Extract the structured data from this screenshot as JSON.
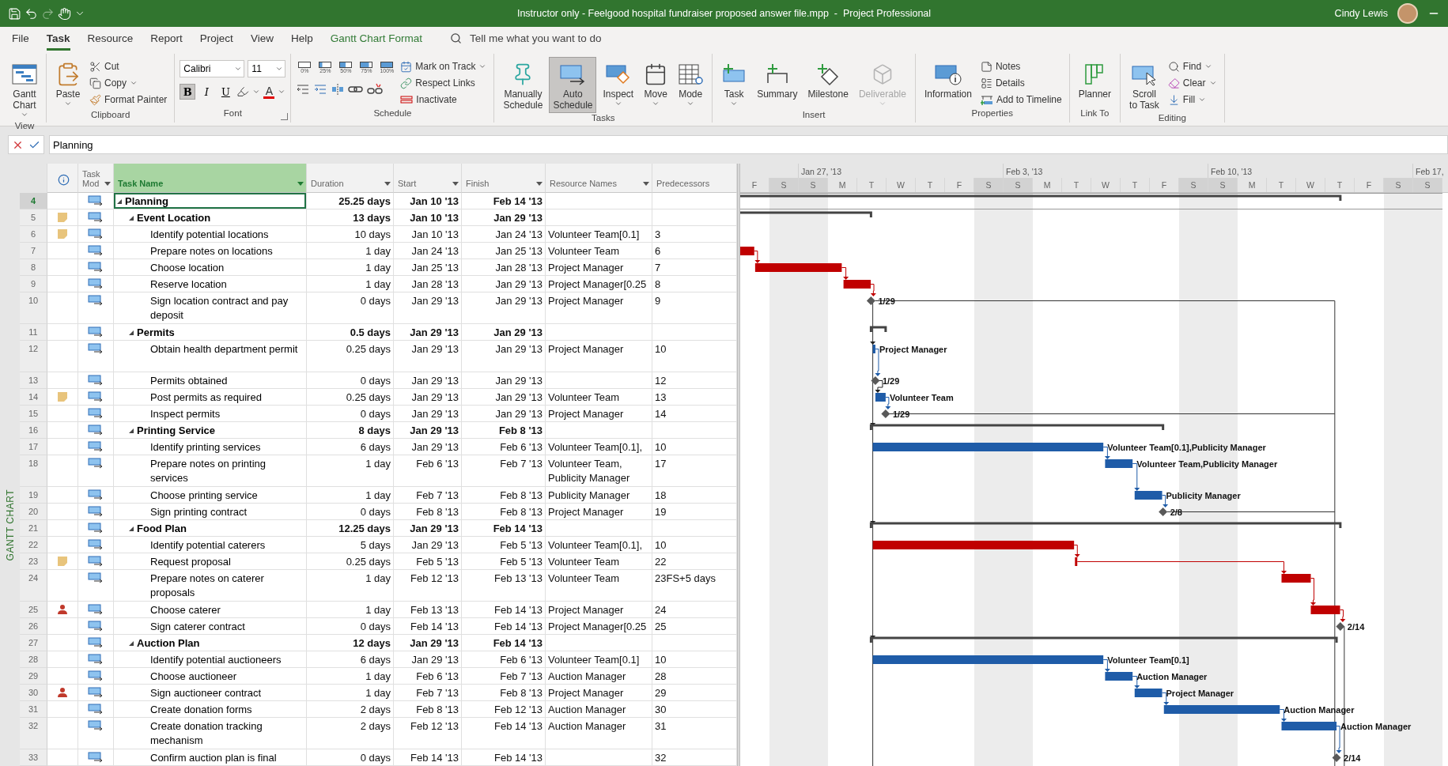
{
  "title_bar": {
    "title": "Instructor only - Feelgood hospital fundraiser proposed answer file.mpp  -  Project Professional",
    "user": "Cindy Lewis"
  },
  "quick_access": {
    "redo_disabled": true
  },
  "menu_tabs": [
    {
      "label": "File",
      "selected": false,
      "kind": "plain"
    },
    {
      "label": "Task",
      "selected": true,
      "kind": "plain"
    },
    {
      "label": "Resource",
      "selected": false,
      "kind": "plain"
    },
    {
      "label": "Report",
      "selected": false,
      "kind": "plain"
    },
    {
      "label": "Project",
      "selected": false,
      "kind": "plain"
    },
    {
      "label": "View",
      "selected": false,
      "kind": "plain"
    },
    {
      "label": "Help",
      "selected": false,
      "kind": "plain"
    },
    {
      "label": "Gantt Chart Format",
      "selected": false,
      "kind": "contextual"
    }
  ],
  "search": {
    "placeholder": "Tell me what you want to do"
  },
  "ribbon": [
    {
      "label": "View",
      "items": [
        {
          "kind": "large",
          "lines": [
            "Gantt",
            "Chart"
          ],
          "dropdown": true,
          "selected": false,
          "disabled": false
        }
      ]
    },
    {
      "label": "Clipboard",
      "items": [
        {
          "kind": "large",
          "lines": [
            "Paste"
          ],
          "dropdown": true,
          "selected": false,
          "disabled": false
        },
        {
          "kind": "stack",
          "items": [
            {
              "label": "Cut",
              "dropdown": false
            },
            {
              "label": "Copy",
              "dropdown": true
            },
            {
              "label": "Format Painter",
              "dropdown": false
            }
          ]
        }
      ]
    },
    {
      "label": "Font",
      "launcher": true,
      "items": [
        {
          "kind": "font",
          "font": "Calibri",
          "size": "11",
          "styles": [
            {
              "label": "B",
              "selected": true
            },
            {
              "label": "I",
              "selected": false
            },
            {
              "label": "U",
              "selected": false
            }
          ],
          "color_label": "A"
        }
      ]
    },
    {
      "label": "Schedule",
      "items": [
        {
          "kind": "percent",
          "values": [
            "0%",
            "25%",
            "50%",
            "75%",
            "100%"
          ]
        },
        {
          "kind": "stack",
          "items": [
            {
              "label": "Mark on Track",
              "dropdown": true
            },
            {
              "label": "Respect Links",
              "dropdown": false
            },
            {
              "label": "Inactivate",
              "dropdown": false
            }
          ]
        }
      ]
    },
    {
      "label": "Tasks",
      "items": [
        {
          "kind": "large",
          "lines": [
            "Manually",
            "Schedule"
          ],
          "dropdown": false,
          "selected": false,
          "disabled": false
        },
        {
          "kind": "large",
          "lines": [
            "Auto",
            "Schedule"
          ],
          "dropdown": false,
          "selected": true,
          "disabled": false
        },
        {
          "kind": "large",
          "lines": [
            "Inspect"
          ],
          "dropdown": true,
          "selected": false,
          "disabled": false
        },
        {
          "kind": "large",
          "lines": [
            "Move"
          ],
          "dropdown": true,
          "selected": false,
          "disabled": false
        },
        {
          "kind": "large",
          "lines": [
            "Mode"
          ],
          "dropdown": true,
          "selected": false,
          "disabled": false
        }
      ]
    },
    {
      "label": "Insert",
      "items": [
        {
          "kind": "large",
          "lines": [
            "Task"
          ],
          "dropdown": true,
          "selected": false,
          "disabled": false
        },
        {
          "kind": "large",
          "lines": [
            "Summary"
          ],
          "dropdown": false,
          "selected": false,
          "disabled": false
        },
        {
          "kind": "large",
          "lines": [
            "Milestone"
          ],
          "dropdown": false,
          "selected": false,
          "disabled": false
        },
        {
          "kind": "large",
          "lines": [
            "Deliverable"
          ],
          "dropdown": true,
          "selected": false,
          "disabled": true
        }
      ]
    },
    {
      "label": "Properties",
      "items": [
        {
          "kind": "large",
          "lines": [
            "Information"
          ],
          "dropdown": false,
          "selected": false,
          "disabled": false
        },
        {
          "kind": "stack",
          "items": [
            {
              "label": "Notes",
              "dropdown": false
            },
            {
              "label": "Details",
              "dropdown": false
            },
            {
              "label": "Add to Timeline",
              "dropdown": false
            }
          ]
        }
      ]
    },
    {
      "label": "Link To",
      "items": [
        {
          "kind": "large",
          "lines": [
            "Planner"
          ],
          "dropdown": false,
          "selected": false,
          "disabled": false
        }
      ]
    },
    {
      "label": "Editing",
      "items": [
        {
          "kind": "large",
          "lines": [
            "Scroll",
            "to Task"
          ],
          "dropdown": false,
          "selected": false,
          "disabled": false
        },
        {
          "kind": "stack",
          "items": [
            {
              "label": "Find",
              "dropdown": true
            },
            {
              "label": "Clear",
              "dropdown": true
            },
            {
              "label": "Fill",
              "dropdown": true
            }
          ]
        }
      ]
    }
  ],
  "entry_bar": {
    "value": "Planning"
  },
  "view_label": "GANTT CHART",
  "columns": [
    {
      "kind": "indicators",
      "selected": false,
      "filter": false
    },
    {
      "kind": "text",
      "label": "Task Mod",
      "selected": false,
      "filter": true
    },
    {
      "kind": "text",
      "label": "Task Name",
      "selected": true,
      "filter": true
    },
    {
      "kind": "text",
      "label": "Duration",
      "selected": false,
      "filter": true
    },
    {
      "kind": "text",
      "label": "Start",
      "selected": false,
      "filter": true
    },
    {
      "kind": "text",
      "label": "Finish",
      "selected": false,
      "filter": true
    },
    {
      "kind": "text",
      "label": "Resource Names",
      "selected": false,
      "filter": true
    },
    {
      "kind": "text",
      "label": "Predecessors",
      "selected": false,
      "filter": false
    }
  ],
  "tasks": [
    {
      "id": "4",
      "kind": "plain",
      "name": "Planning",
      "duration": "25.25 days",
      "start": "Jan 10 '13",
      "finish": "Feb 14 '13",
      "selected": true,
      "expanded": true,
      "bar": {
        "kind": "summary"
      },
      "children": [
        {
          "id": "5",
          "kind": "note",
          "name": "Event Location",
          "duration": "13 days",
          "start": "Jan 10 '13",
          "finish": "Jan 29 '13",
          "selected": false,
          "expanded": true,
          "bar": {
            "kind": "summary"
          },
          "children": [
            {
              "id": "6",
              "kind": "note",
              "name": "Identify potential locations",
              "duration": "10 days",
              "start": "Jan 10 '13",
              "finish": "Jan 24 '13",
              "resources": "Volunteer Team[0.1]",
              "predecessors": "3",
              "selected": false
            },
            {
              "id": "7",
              "kind": "plain",
              "name": "Prepare notes on locations",
              "duration": "1 day",
              "start": "Jan 24 '13",
              "finish": "Jan 25 '13",
              "resources": "Volunteer Team",
              "predecessors": "6",
              "selected": false,
              "bar": {
                "kind": "task",
                "color": "#c00000"
              }
            },
            {
              "id": "8",
              "kind": "plain",
              "name": "Choose location",
              "duration": "1 day",
              "start": "Jan 25 '13",
              "finish": "Jan 28 '13",
              "resources": "Project Manager",
              "predecessors": "7",
              "selected": false,
              "bar": {
                "kind": "task",
                "color": "#c00000"
              }
            },
            {
              "id": "9",
              "kind": "plain",
              "name": "Reserve location",
              "duration": "1 day",
              "start": "Jan 28 '13",
              "finish": "Jan 29 '13",
              "resources": "Project Manager[0.25",
              "predecessors": "8",
              "selected": false,
              "bar": {
                "kind": "task",
                "color": "#c00000"
              }
            },
            {
              "id": "10",
              "kind": "plain",
              "name": "Sign location contract and pay deposit",
              "duration": "0 days",
              "start": "Jan 29 '13",
              "finish": "Jan 29 '13",
              "resources": "Project Manager",
              "predecessors": "9",
              "selected": false,
              "bar": {
                "kind": "milestone",
                "label": "1/29"
              }
            }
          ]
        },
        {
          "id": "11",
          "kind": "plain",
          "name": "Permits",
          "duration": "0.5 days",
          "start": "Jan 29 '13",
          "finish": "Jan 29 '13",
          "selected": false,
          "expanded": true,
          "bar": {
            "kind": "summary"
          },
          "children": [
            {
              "id": "12",
              "kind": "plain",
              "name": "Obtain health department permit",
              "duration": "0.25 days",
              "start": "Jan 29 '13",
              "finish": "Jan 29 '13",
              "resources": "Project Manager",
              "predecessors": "10",
              "selected": false,
              "bar": {
                "kind": "task",
                "color": "#1f5ca8",
                "label": "Project Manager"
              }
            },
            {
              "id": "13",
              "kind": "plain",
              "name": "Permits obtained",
              "duration": "0 days",
              "start": "Jan 29 '13",
              "finish": "Jan 29 '13",
              "predecessors": "12",
              "selected": false,
              "bar": {
                "kind": "milestone",
                "label": "1/29"
              }
            },
            {
              "id": "14",
              "kind": "note",
              "name": "Post permits as required",
              "duration": "0.25 days",
              "start": "Jan 29 '13",
              "finish": "Jan 29 '13",
              "resources": "Volunteer Team",
              "predecessors": "13",
              "selected": false,
              "bar": {
                "kind": "task",
                "color": "#1f5ca8",
                "label": "Volunteer Team"
              }
            },
            {
              "id": "15",
              "kind": "plain",
              "name": "Inspect permits",
              "duration": "0 days",
              "start": "Jan 29 '13",
              "finish": "Jan 29 '13",
              "resources": "Project Manager",
              "predecessors": "14",
              "selected": false,
              "bar": {
                "kind": "milestone",
                "label": "1/29"
              }
            }
          ]
        },
        {
          "id": "16",
          "kind": "plain",
          "name": "Printing Service",
          "duration": "8 days",
          "start": "Jan 29 '13",
          "finish": "Feb 8 '13",
          "selected": false,
          "expanded": true,
          "bar": {
            "kind": "summary"
          },
          "children": [
            {
              "id": "17",
              "kind": "plain",
              "name": "Identify printing services",
              "duration": "6 days",
              "start": "Jan 29 '13",
              "finish": "Feb 6 '13",
              "resources": "Volunteer Team[0.1],",
              "predecessors": "10",
              "selected": false,
              "bar": {
                "kind": "task",
                "color": "#1f5ca8",
                "label": "Volunteer Team[0.1],Publicity Manager"
              }
            },
            {
              "id": "18",
              "kind": "plain",
              "name": "Prepare notes on printing services",
              "duration": "1 day",
              "start": "Feb 6 '13",
              "finish": "Feb 7 '13",
              "resources": "Volunteer Team, Publicity Manager",
              "predecessors": "17",
              "selected": false,
              "bar": {
                "kind": "task",
                "color": "#1f5ca8",
                "label": "Volunteer Team,Publicity Manager"
              }
            },
            {
              "id": "19",
              "kind": "plain",
              "name": "Choose printing service",
              "duration": "1 day",
              "start": "Feb 7 '13",
              "finish": "Feb 8 '13",
              "resources": "Publicity Manager",
              "predecessors": "18",
              "selected": false,
              "bar": {
                "kind": "task",
                "color": "#1f5ca8",
                "label": "Publicity Manager"
              }
            },
            {
              "id": "20",
              "kind": "plain",
              "name": "Sign printing contract",
              "duration": "0 days",
              "start": "Feb 8 '13",
              "finish": "Feb 8 '13",
              "resources": "Project Manager",
              "predecessors": "19",
              "selected": false,
              "bar": {
                "kind": "milestone",
                "label": "2/8"
              }
            }
          ]
        },
        {
          "id": "21",
          "kind": "plain",
          "name": "Food Plan",
          "duration": "12.25 days",
          "start": "Jan 29 '13",
          "finish": "Feb 14 '13",
          "selected": false,
          "expanded": true,
          "bar": {
            "kind": "summary"
          },
          "children": [
            {
              "id": "22",
              "kind": "plain",
              "name": "Identify potential caterers",
              "duration": "5 days",
              "start": "Jan 29 '13",
              "finish": "Feb 5 '13",
              "resources": "Volunteer Team[0.1],",
              "predecessors": "10",
              "selected": false,
              "bar": {
                "kind": "task",
                "color": "#c00000"
              }
            },
            {
              "id": "23",
              "kind": "note",
              "name": "Request proposal",
              "duration": "0.25 days",
              "start": "Feb 5 '13",
              "finish": "Feb 5 '13",
              "resources": "Volunteer Team",
              "predecessors": "22",
              "selected": false,
              "bar": {
                "kind": "task",
                "color": "#c00000"
              }
            },
            {
              "id": "24",
              "kind": "plain",
              "name": "Prepare notes on caterer proposals",
              "duration": "1 day",
              "start": "Feb 12 '13",
              "finish": "Feb 13 '13",
              "resources": "Volunteer Team",
              "predecessors": "23FS+5 days",
              "selected": false,
              "bar": {
                "kind": "task",
                "color": "#c00000"
              }
            },
            {
              "id": "25",
              "kind": "person",
              "name": "Choose caterer",
              "duration": "1 day",
              "start": "Feb 13 '13",
              "finish": "Feb 14 '13",
              "resources": "Project Manager",
              "predecessors": "24",
              "selected": false,
              "bar": {
                "kind": "task",
                "color": "#c00000"
              }
            },
            {
              "id": "26",
              "kind": "plain",
              "name": "Sign caterer contract",
              "duration": "0 days",
              "start": "Feb 14 '13",
              "finish": "Feb 14 '13",
              "resources": "Project Manager[0.25",
              "predecessors": "25",
              "selected": false,
              "bar": {
                "kind": "milestone",
                "label": "2/14"
              }
            }
          ]
        },
        {
          "id": "27",
          "kind": "plain",
          "name": "Auction Plan",
          "duration": "12 days",
          "start": "Jan 29 '13",
          "finish": "Feb 14 '13",
          "selected": false,
          "expanded": true,
          "bar": {
            "kind": "summary"
          },
          "children": [
            {
              "id": "28",
              "kind": "plain",
              "name": "Identify potential auctioneers",
              "duration": "6 days",
              "start": "Jan 29 '13",
              "finish": "Feb 6 '13",
              "resources": "Volunteer Team[0.1]",
              "predecessors": "10",
              "selected": false,
              "bar": {
                "kind": "task",
                "color": "#1f5ca8",
                "label": "Volunteer Team[0.1]"
              }
            },
            {
              "id": "29",
              "kind": "plain",
              "name": "Choose auctioneer",
              "duration": "1 day",
              "start": "Feb 6 '13",
              "finish": "Feb 7 '13",
              "resources": "Auction Manager",
              "predecessors": "28",
              "selected": false,
              "bar": {
                "kind": "task",
                "color": "#1f5ca8",
                "label": "Auction Manager"
              }
            },
            {
              "id": "30",
              "kind": "person",
              "name": "Sign auctioneer contract",
              "duration": "1 day",
              "start": "Feb 7 '13",
              "finish": "Feb 8 '13",
              "resources": "Project Manager",
              "predecessors": "29",
              "selected": false,
              "bar": {
                "kind": "task",
                "color": "#1f5ca8",
                "label": "Project Manager"
              }
            },
            {
              "id": "31",
              "kind": "plain",
              "name": "Create donation forms",
              "duration": "2 days",
              "start": "Feb 8 '13",
              "finish": "Feb 12 '13",
              "resources": "Auction Manager",
              "predecessors": "30",
              "selected": false,
              "bar": {
                "kind": "task",
                "color": "#1f5ca8",
                "label": "Auction Manager"
              }
            },
            {
              "id": "32",
              "kind": "plain",
              "name": "Create donation tracking mechanism",
              "duration": "2 days",
              "start": "Feb 12 '13",
              "finish": "Feb 14 '13",
              "resources": "Auction Manager",
              "predecessors": "31",
              "selected": false,
              "bar": {
                "kind": "task",
                "color": "#1f5ca8",
                "label": "Auction Manager"
              }
            },
            {
              "id": "33",
              "kind": "plain",
              "name": "Confirm auction plan is final",
              "duration": "0 days",
              "start": "Feb 14 '13",
              "finish": "Feb 14 '13",
              "predecessors": "32",
              "selected": false,
              "bar": {
                "kind": "milestone",
                "label": "2/14"
              }
            }
          ]
        }
      ]
    }
  ],
  "timescale": {
    "weeks": [
      {
        "label": "Jan 27, '13"
      },
      {
        "label": "Feb 3, '13"
      },
      {
        "label": "Feb 10, '13"
      },
      {
        "label": "Feb 17,"
      }
    ],
    "days": [
      {
        "letter": "F",
        "weekend": false
      },
      {
        "letter": "S",
        "weekend": true
      },
      {
        "letter": "S",
        "weekend": true
      },
      {
        "letter": "M",
        "weekend": false
      },
      {
        "letter": "T",
        "weekend": false
      },
      {
        "letter": "W",
        "weekend": false
      },
      {
        "letter": "T",
        "weekend": false
      },
      {
        "letter": "F",
        "weekend": false
      },
      {
        "letter": "S",
        "weekend": true
      },
      {
        "letter": "S",
        "weekend": true
      },
      {
        "letter": "M",
        "weekend": false
      },
      {
        "letter": "T",
        "weekend": false
      },
      {
        "letter": "W",
        "weekend": false
      },
      {
        "letter": "T",
        "weekend": false
      },
      {
        "letter": "F",
        "weekend": false
      },
      {
        "letter": "S",
        "weekend": true
      },
      {
        "letter": "S",
        "weekend": true
      },
      {
        "letter": "M",
        "weekend": false
      },
      {
        "letter": "T",
        "weekend": false
      },
      {
        "letter": "W",
        "weekend": false
      },
      {
        "letter": "T",
        "weekend": false
      },
      {
        "letter": "F",
        "weekend": false
      },
      {
        "letter": "S",
        "weekend": true
      },
      {
        "letter": "S",
        "weekend": true
      }
    ]
  }
}
